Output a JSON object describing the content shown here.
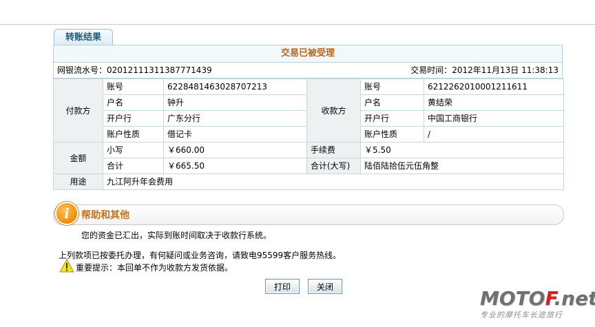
{
  "tab": {
    "label": "转账结果"
  },
  "status": {
    "title": "交易已被受理"
  },
  "serial": {
    "label": "网银流水号：",
    "value": "02012111311387771439"
  },
  "trade_time": {
    "label": "交易时间：",
    "value": "2012年11月13日 11:38:13"
  },
  "payer": {
    "header": "付款方",
    "rows": [
      {
        "label": "账号",
        "value": "6228481463028707213"
      },
      {
        "label": "户名",
        "value": "钟升"
      },
      {
        "label": "开户行",
        "value": "广东分行"
      },
      {
        "label": "账户性质",
        "value": "借记卡"
      }
    ]
  },
  "payee": {
    "header": "收款方",
    "rows": [
      {
        "label": "账号",
        "value": "6212262010001211611"
      },
      {
        "label": "户名",
        "value": "黄结荣"
      },
      {
        "label": "开户行",
        "value": "中国工商银行"
      },
      {
        "label": "账户性质",
        "value": "/"
      }
    ]
  },
  "amount": {
    "header": "金额",
    "small_label": "小写",
    "small_value": "￥660.00",
    "fee_label": "手续费",
    "fee_value": "￥5.50",
    "total_label": "合计",
    "total_value": "￥665.50",
    "total_upper_label": "合计(大写)",
    "total_upper_value": "陆佰陆拾伍元伍角整"
  },
  "purpose": {
    "label": "用途",
    "value": "九江阿升年会费用"
  },
  "help": {
    "title": "帮助和其他",
    "text": "您的资金已汇出，实际到账时间取决于收款行系统。"
  },
  "notice": "上列款项已按委托办理，有何疑问或业务咨询，请致电95599客户服务热线。",
  "warning": "重要提示：本回单不作为收款方发货依据。",
  "buttons": {
    "print": "打印",
    "close": "关闭"
  },
  "watermark": {
    "main_gray": "MOTO",
    "main_red": "F",
    "main_tail": ".net",
    "sub": "专业的摩托车长途旅行"
  }
}
